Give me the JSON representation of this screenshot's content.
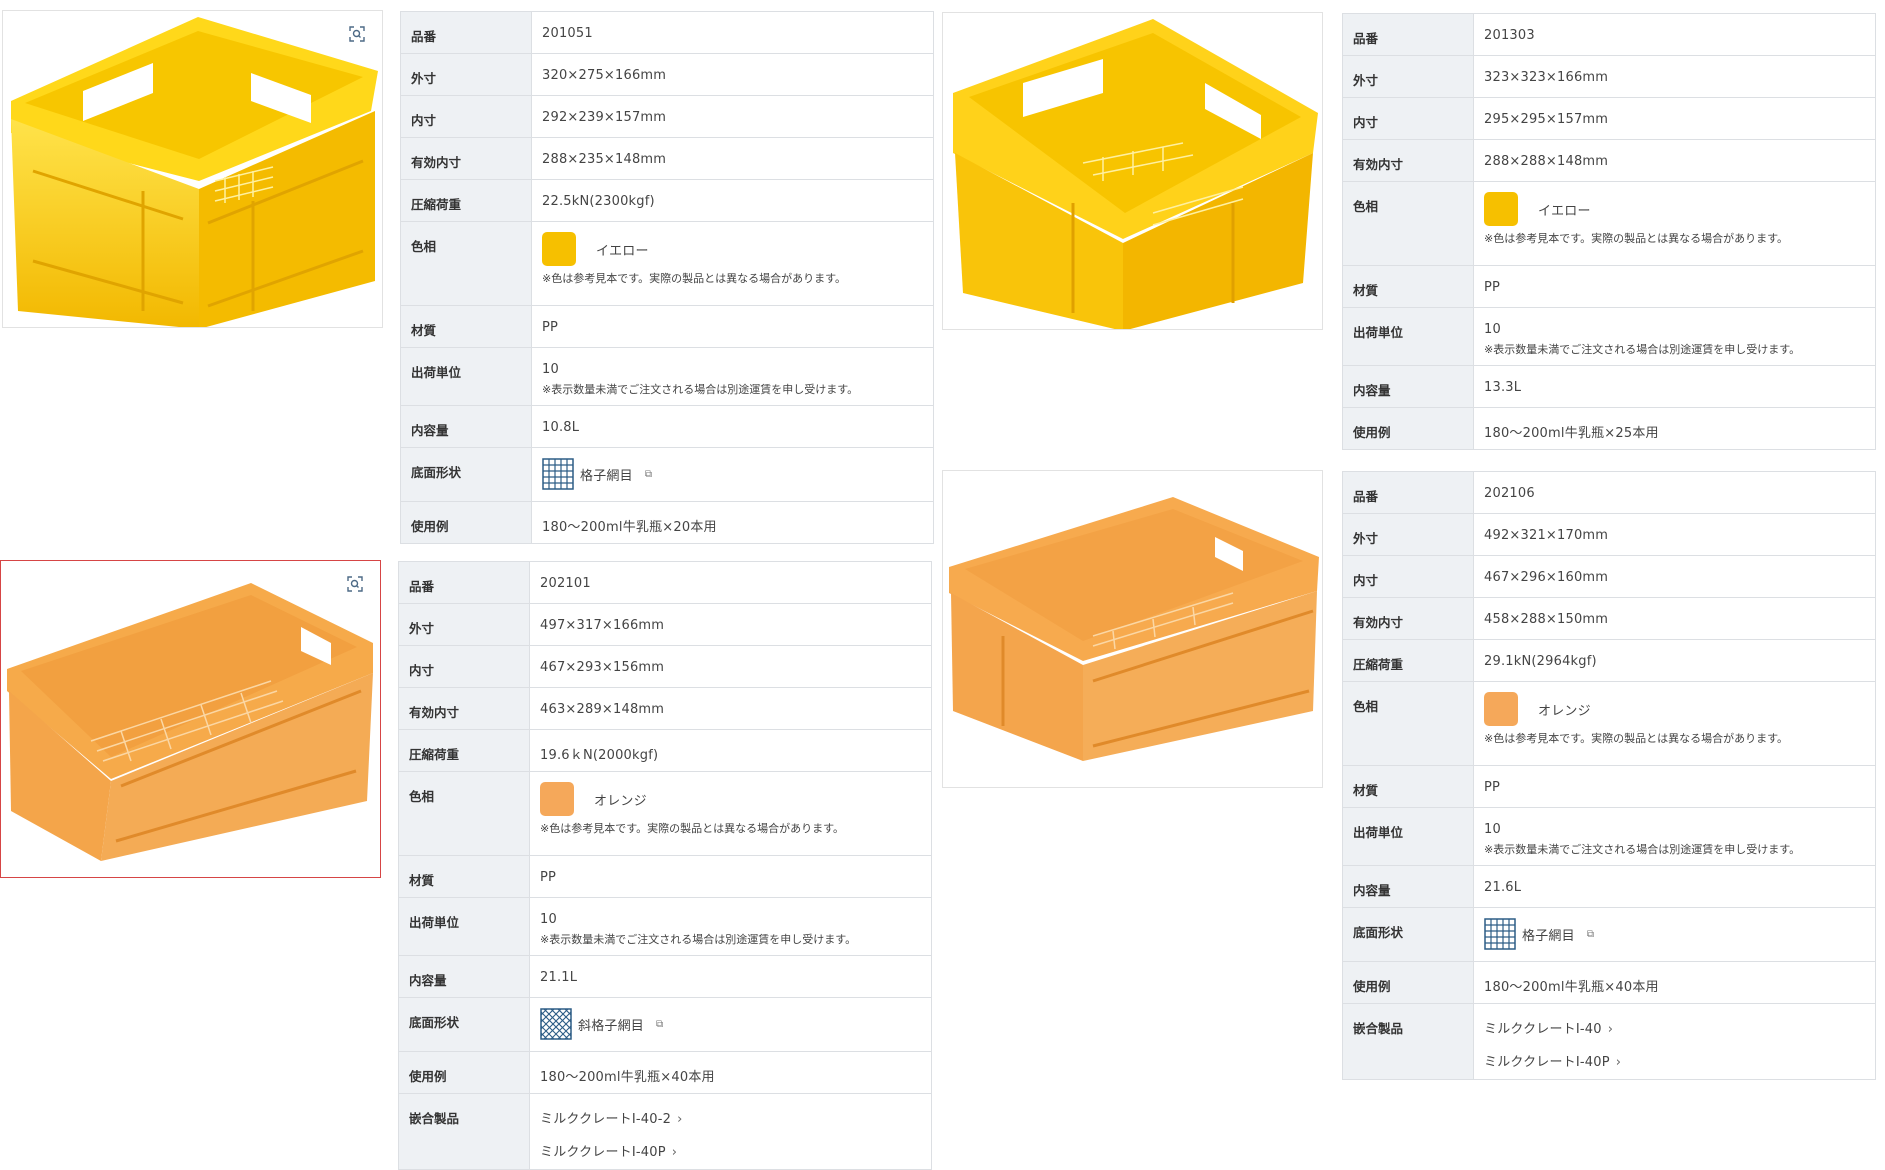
{
  "products": [
    {
      "colors": {
        "swatch": "#F6C000"
      },
      "bottom_pattern": "grid",
      "rows": {
        "k_code": "品番",
        "code": "201051",
        "k_outer": "外寸",
        "outer": "320×275×166mm",
        "k_inner": "内寸",
        "inner": "292×239×157mm",
        "k_effective": "有効内寸",
        "effective": "288×235×148mm",
        "k_load": "圧縮荷重",
        "load": "22.5kN(2300kgf)",
        "k_color": "色相",
        "color_name": "イエロー",
        "color_note": "※色は参考見本です。実際の製品とは異なる場合があります。",
        "k_material": "材質",
        "material": "PP",
        "k_unit": "出荷単位",
        "unit": "10",
        "unit_note": "※表示数量未満でご注文される場合は別途運賃を申し受けます。",
        "k_capacity": "内容量",
        "capacity": "10.8L",
        "k_bottom": "底面形状",
        "bottom": "格子網目",
        "k_usage": "使用例",
        "usage": "180～200ml牛乳瓶×20本用"
      }
    },
    {
      "colors": {
        "swatch": "#F6C000"
      },
      "rows": {
        "k_code": "品番",
        "code": "201303",
        "k_outer": "外寸",
        "outer": "323×323×166mm",
        "k_inner": "内寸",
        "inner": "295×295×157mm",
        "k_effective": "有効内寸",
        "effective": "288×288×148mm",
        "k_color": "色相",
        "color_name": "イエロー",
        "color_note": "※色は参考見本です。実際の製品とは異なる場合があります。",
        "k_material": "材質",
        "material": "PP",
        "k_unit": "出荷単位",
        "unit": "10",
        "unit_note": "※表示数量未満でご注文される場合は別途運賃を申し受けます。",
        "k_capacity": "内容量",
        "capacity": "13.3L",
        "k_usage": "使用例",
        "usage": "180～200ml牛乳瓶×25本用"
      }
    },
    {
      "colors": {
        "swatch": "#F5A85A"
      },
      "bottom_pattern": "diagonal",
      "rows": {
        "k_code": "品番",
        "code": "202101",
        "k_outer": "外寸",
        "outer": "497×317×166mm",
        "k_inner": "内寸",
        "inner": "467×293×156mm",
        "k_effective": "有効内寸",
        "effective": "463×289×148mm",
        "k_load": "圧縮荷重",
        "load": "19.6ｋN(2000kgf)",
        "k_color": "色相",
        "color_name": "オレンジ",
        "color_note": "※色は参考見本です。実際の製品とは異なる場合があります。",
        "k_material": "材質",
        "material": "PP",
        "k_unit": "出荷単位",
        "unit": "10",
        "unit_note": "※表示数量未満でご注文される場合は別途運賃を申し受けます。",
        "k_capacity": "内容量",
        "capacity": "21.1L",
        "k_bottom": "底面形状",
        "bottom": "斜格子網目",
        "k_usage": "使用例",
        "usage": "180～200ml牛乳瓶×40本用",
        "k_related": "嵌合製品",
        "related": [
          "ミルククレートI-40-2",
          "ミルククレートI-40P"
        ]
      }
    },
    {
      "colors": {
        "swatch": "#F5A85A"
      },
      "bottom_pattern": "grid",
      "rows": {
        "k_code": "品番",
        "code": "202106",
        "k_outer": "外寸",
        "outer": "492×321×170mm",
        "k_inner": "内寸",
        "inner": "467×296×160mm",
        "k_effective": "有効内寸",
        "effective": "458×288×150mm",
        "k_load": "圧縮荷重",
        "load": "29.1kN(2964kgf)",
        "k_color": "色相",
        "color_name": "オレンジ",
        "color_note": "※色は参考見本です。実際の製品とは異なる場合があります。",
        "k_material": "材質",
        "material": "PP",
        "k_unit": "出荷単位",
        "unit": "10",
        "unit_note": "※表示数量未満でご注文される場合は別途運賃を申し受けます。",
        "k_capacity": "内容量",
        "capacity": "21.6L",
        "k_bottom": "底面形状",
        "bottom": "格子網目",
        "k_usage": "使用例",
        "usage": "180～200ml牛乳瓶×40本用",
        "k_related": "嵌合製品",
        "related": [
          "ミルククレートI-40",
          "ミルククレートI-40P"
        ]
      }
    }
  ],
  "icons": {
    "zoom": "zoom-magnifier-icon",
    "external": "external-link-icon",
    "chevron": "chevron-right-icon"
  }
}
